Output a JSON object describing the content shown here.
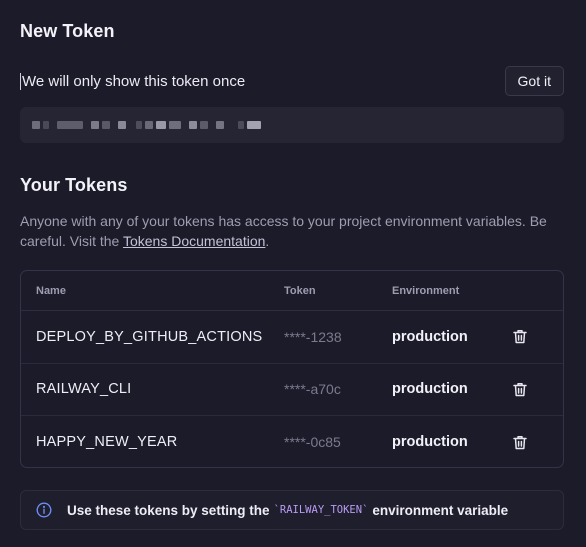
{
  "new_token": {
    "title": "New Token",
    "once_message": "We will only show this token once",
    "got_it_label": "Got it"
  },
  "your_tokens": {
    "title": "Your Tokens",
    "description_before": "Anyone with any of your tokens has access to your project environment variables. Be careful. Visit the ",
    "docs_link": "Tokens Documentation",
    "description_after": ".",
    "columns": {
      "name": "Name",
      "token": "Token",
      "environment": "Environment"
    },
    "rows": [
      {
        "name": "DEPLOY_BY_GITHUB_ACTIONS",
        "token": "****-1238",
        "environment": "production"
      },
      {
        "name": "RAILWAY_CLI",
        "token": "****-a70c",
        "environment": "production"
      },
      {
        "name": "HAPPY_NEW_YEAR",
        "token": "****-0c85",
        "environment": "production"
      }
    ]
  },
  "note": {
    "icon": "info-icon",
    "before": "Use these tokens by setting the",
    "code": "`RAILWAY_TOKEN`",
    "after": "environment variable"
  },
  "colors": {
    "background": "#1c1b29",
    "code_accent": "#b99bf5",
    "info_icon": "#6b8cf5"
  }
}
